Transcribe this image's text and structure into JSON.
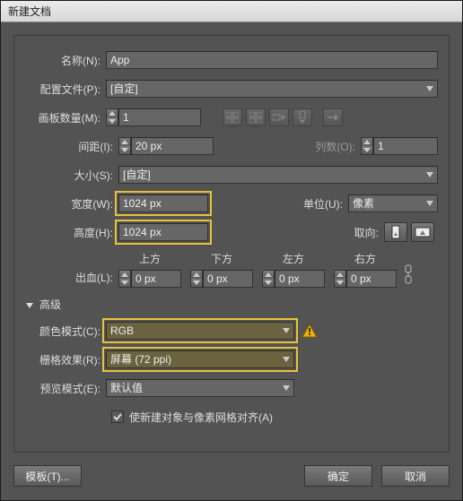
{
  "title": "新建文档",
  "labels": {
    "name": "名称(N):",
    "profile": "配置文件(P):",
    "artboards": "画板数量(M):",
    "spacing": "间距(I):",
    "columns": "列数(O):",
    "size": "大小(S):",
    "width": "宽度(W):",
    "height": "高度(H):",
    "unit": "单位(U):",
    "orientation": "取向:",
    "bleed": "出血(L):",
    "top": "上方",
    "bottom": "下方",
    "left": "左方",
    "right": "右方",
    "advanced": "高级",
    "colorMode": "颜色模式(C):",
    "raster": "栅格效果(R):",
    "preview": "预览模式(E):",
    "alignGrid": "使新建对象与像素网格对齐(A)",
    "template": "模板(T)...",
    "ok": "确定",
    "cancel": "取消"
  },
  "values": {
    "name": "App",
    "profile": "[自定]",
    "artboards": "1",
    "spacing": "20 px",
    "columns": "1",
    "size": "[自定]",
    "width": "1024 px",
    "height": "1024 px",
    "unit": "像素",
    "bleed_top": "0 px",
    "bleed_bottom": "0 px",
    "bleed_left": "0 px",
    "bleed_right": "0 px",
    "colorMode": "RGB",
    "raster": "屏幕 (72 ppi)",
    "preview": "默认值",
    "alignGrid_checked": true
  },
  "icons": {
    "arrow_down": "chevron-down",
    "arrow_right": "chevron-right"
  }
}
